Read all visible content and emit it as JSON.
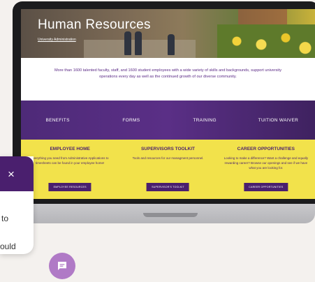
{
  "hero": {
    "title": "Human Resources",
    "subtitle": "University Administration"
  },
  "intro": {
    "text": "More than 1600 talented faculty, staff, and 1600 student employees with a wide variety of skills and backgrounds, support university operations every day as well as the continued growth of our diverse community."
  },
  "nav": {
    "items": [
      "BENEFITS",
      "FORMS",
      "TRAINING",
      "TUITION WAIVER"
    ]
  },
  "cards": [
    {
      "title": "EMPLOYEE HOME",
      "desc": "Everything you need from Administrative Applications to timesheets can be found in your employee home!",
      "button": "EMPLOYEE RESOURCES"
    },
    {
      "title": "SUPERVISORS TOOLKIT",
      "desc": "Tools and resources for our managment personnel.",
      "button": "SUPERVISOR'S TOOLKIT"
    },
    {
      "title": "CAREER OPPORTUNITIES",
      "desc": "Looking to make a difference? Want a challenge and equally rewarding career? Browse our openings and see if we have what you are looking for.",
      "button": "CAREER OPPORTUNITIES"
    }
  ],
  "chat": {
    "close_icon": "×",
    "line1": "to",
    "line2": "ould"
  },
  "colors": {
    "purple": "#4a1f6e",
    "yellow": "#f2e24b",
    "chat_fab": "#b07ac6"
  }
}
